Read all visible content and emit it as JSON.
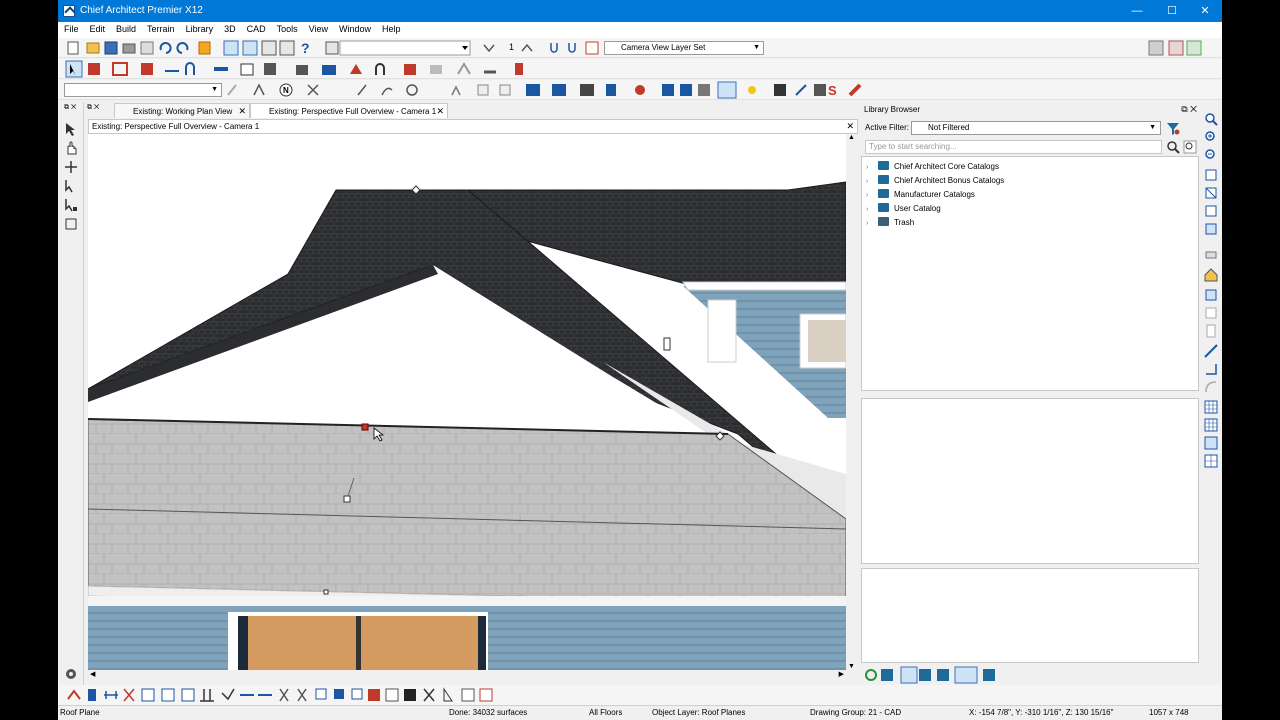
{
  "window": {
    "title": "Chief Architect Premier X12",
    "minimize": "—",
    "maximize": "☐",
    "close": "✕"
  },
  "menu": [
    "File",
    "Edit",
    "Build",
    "Terrain",
    "Library",
    "3D",
    "CAD",
    "Tools",
    "View",
    "Window",
    "Help"
  ],
  "toolbar1": {
    "floor_number": "1",
    "layer_set": "Camera View Layer Set"
  },
  "tabs": [
    {
      "label": "Existing:  Working Plan View",
      "close": "✕"
    },
    {
      "label": "Existing:  Perspective Full Overview - Camera 1",
      "close": "✕"
    }
  ],
  "view": {
    "header": "Existing: Perspective Full Overview - Camera 1",
    "close": "✕"
  },
  "library": {
    "title": "Library Browser",
    "header_controls": "⧉ ✕",
    "filter_label": "Active Filter:",
    "filter_value": "Not Filtered",
    "search_placeholder": "Type to start searching...",
    "items": [
      {
        "label": "Chief Architect Core Catalogs"
      },
      {
        "label": "Chief Architect Bonus Catalogs"
      },
      {
        "label": "Manufacturer Catalogs"
      },
      {
        "label": "User Catalog"
      },
      {
        "label": "Trash"
      }
    ]
  },
  "status": {
    "object": "Roof Plane",
    "done": "Done:  34032 surfaces",
    "floors": "All Floors",
    "object_layer": "Object Layer: Roof Planes",
    "drawing_group": "Drawing Group: 21 - CAD",
    "coords": "X: -154 7/8\", Y: -310 1/16\", Z: 130 15/16\"",
    "size": "1057 x 748"
  },
  "colors": {
    "title_bar": "#0078d7",
    "roof_shingle": "#2c2d31",
    "lower_roof": "#bdbdbd",
    "siding": "#7fa3ba",
    "gable_wall": "#ffffff",
    "door": "#d59a60",
    "folder": "#1e6b9a"
  }
}
